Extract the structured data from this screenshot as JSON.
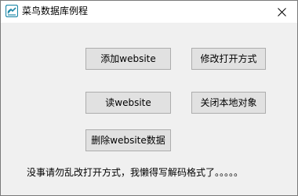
{
  "window": {
    "title": "菜鸟数据库例程",
    "icon": "app-icon",
    "close_icon": "close-icon"
  },
  "buttons": {
    "add_website": "添加website",
    "change_open_mode": "修改打开方式",
    "read_website": "读website",
    "close_local_object": "关闭本地对象",
    "delete_website_data": "删除website数据"
  },
  "status": {
    "message": "没事请勿乱改打开方式，我懒得写解码格式了。。。。。"
  },
  "colors": {
    "title_bar": "#ffffff",
    "client_bg": "#f0f0f0",
    "button_bg": "#e1e1e1",
    "button_border": "#adadad",
    "icon_accent": "#1e88a8"
  }
}
